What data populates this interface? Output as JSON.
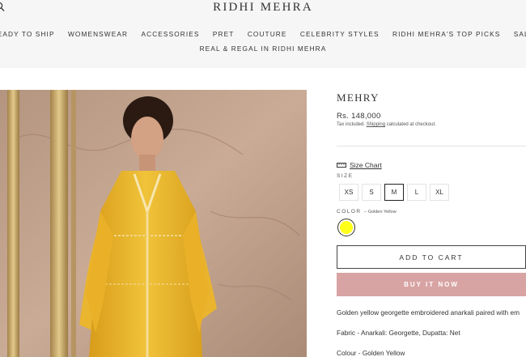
{
  "header": {
    "brand": "RIDHI MEHRA",
    "nav_row1": [
      "READY TO SHIP",
      "WOMENSWEAR",
      "ACCESSORIES",
      "PRET",
      "COUTURE",
      "CELEBRITY STYLES",
      "RIDHI MEHRA'S TOP PICKS",
      "SALE"
    ],
    "nav_row2": [
      "REAL & REGAL IN RIDHI MEHRA"
    ]
  },
  "product": {
    "title": "MEHRY",
    "price": "Rs. 148,000",
    "tax_prefix": "Tax included.",
    "tax_link": "Shipping",
    "tax_suffix": "calculated at checkout.",
    "size_chart_label": "Size Chart",
    "size_label": "SIZE",
    "sizes": [
      "XS",
      "S",
      "M",
      "L",
      "XL"
    ],
    "selected_size": "M",
    "color_label": "COLOR",
    "color_value": "-- Golden Yellow",
    "swatch_color": "#ffff1a",
    "add_to_cart": "ADD TO CART",
    "buy_now": "BUY IT NOW",
    "description": [
      "Golden yellow georgette embroidered anarkali paired with em",
      "Fabric - Anarkali: Georgette, Dupatta: Net",
      "Colour - Golden Yellow"
    ]
  },
  "colors": {
    "accent": "#d8a3a3",
    "header_bg": "#f6f6f6",
    "garment": "#e8b320"
  }
}
